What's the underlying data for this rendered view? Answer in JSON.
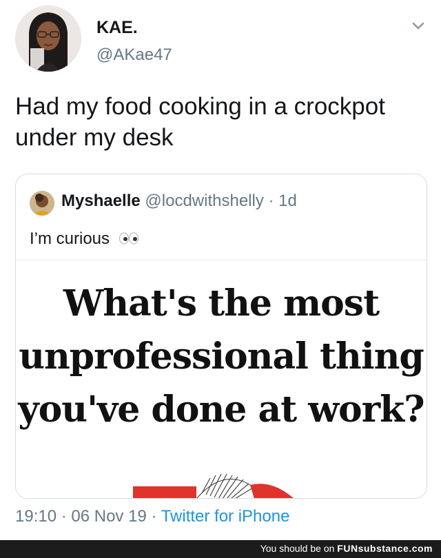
{
  "tweet": {
    "display_name": "KAE.",
    "handle": "@AKae47",
    "text": "Had my food cooking in a crockpot under my desk",
    "timestamp": "19:10 · 06 Nov 19 · ",
    "source": "Twitter for iPhone"
  },
  "quoted_tweet": {
    "display_name": "Myshaelle",
    "handle": "@locdwithshelly",
    "age": "· 1d",
    "text": "I’m curious",
    "media_text": "What's the most unprofessional thing you've done at work?"
  },
  "footer": {
    "text": "You should be on ",
    "brand": "FUNsubstance.com"
  },
  "icons": {
    "chevron": "chevron-down-icon",
    "eyes": "eyes-emoji-icon"
  },
  "colors": {
    "primary_text": "#14171a",
    "secondary_text": "#657786",
    "link": "#1b95e0",
    "border": "#d6dde3",
    "footer_bg": "#1c1c1c"
  }
}
